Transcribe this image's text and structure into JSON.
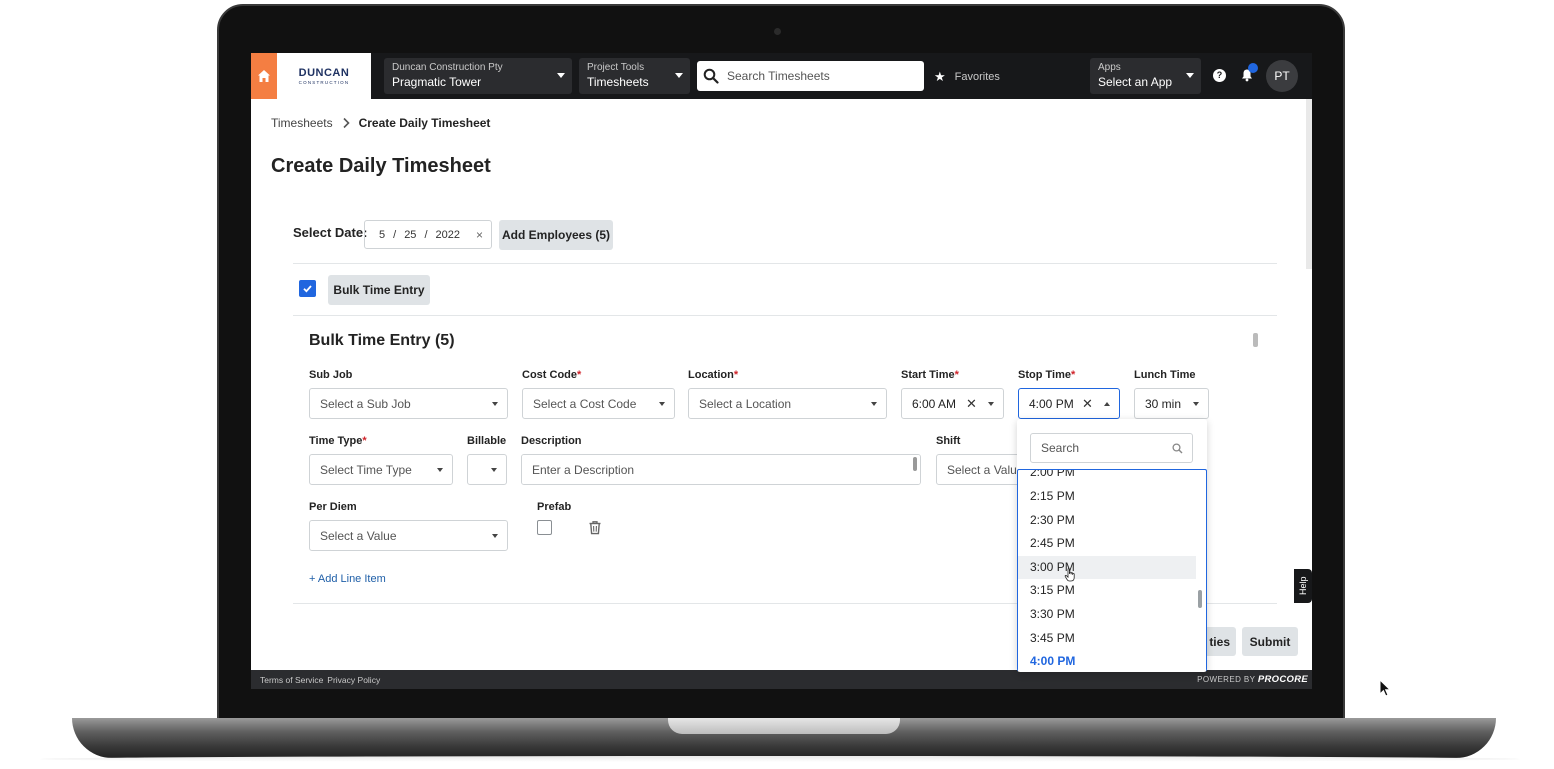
{
  "nav": {
    "company_small": "Duncan Construction Pty",
    "company_project": "Pragmatic Tower",
    "tools_small": "Project Tools",
    "tools_current": "Timesheets",
    "search_placeholder": "Search Timesheets",
    "favorites": "Favorites",
    "apps_small": "Apps",
    "apps_select": "Select an App",
    "help_glyph": "?",
    "avatar_initials": "PT",
    "logo_text": "DUNCAN",
    "logo_sub": "CONSTRUCTION",
    "accent_color": "#f47e42"
  },
  "breadcrumb": {
    "parent": "Timesheets",
    "separator": ">",
    "current": "Create Daily Timesheet"
  },
  "page": {
    "title": "Create Daily Timesheet"
  },
  "date_row": {
    "label": "Select Date:",
    "month": "5",
    "sep": "/",
    "day": "25",
    "year": "2022",
    "clear": "×",
    "add_employees": "Add Employees (5)"
  },
  "bulk": {
    "toggle_label": "Bulk Time Entry",
    "section_title": "Bulk Time Entry (5)",
    "fields": {
      "sub_job": {
        "label": "Sub Job",
        "placeholder": "Select a Sub Job"
      },
      "cost_code": {
        "label": "Cost Code",
        "placeholder": "Select a Cost Code"
      },
      "location": {
        "label": "Location",
        "placeholder": "Select a Location"
      },
      "start_time": {
        "label": "Start Time",
        "value": "6:00 AM"
      },
      "stop_time": {
        "label": "Stop Time",
        "value": "4:00 PM"
      },
      "lunch_time": {
        "label": "Lunch Time",
        "value": "30 min"
      },
      "time_type": {
        "label": "Time Type",
        "placeholder": "Select Time Type"
      },
      "billable": {
        "label": "Billable"
      },
      "description": {
        "label": "Description",
        "placeholder": "Enter a Description"
      },
      "shift": {
        "label": "Shift",
        "placeholder": "Select a Value"
      },
      "per_diem": {
        "label": "Per Diem",
        "placeholder": "Select a Value"
      },
      "prefab": {
        "label": "Prefab"
      }
    },
    "required_mark": "*",
    "clear_glyph": "✕",
    "add_line_item": "+ Add Line Item"
  },
  "stop_time_dropdown": {
    "search_placeholder": "Search",
    "partial_top_item": "2:00 PM",
    "items": [
      "2:15 PM",
      "2:30 PM",
      "2:45 PM",
      "3:00 PM",
      "3:15 PM",
      "3:30 PM",
      "3:45 PM",
      "4:00 PM"
    ],
    "hovered": "3:00 PM",
    "selected": "4:00 PM"
  },
  "actions": {
    "partial_button": "ties",
    "submit": "Submit"
  },
  "help_tab": "Help",
  "footer": {
    "terms": "Terms of Service",
    "privacy": "Privacy Policy",
    "powered_by": "POWERED BY",
    "brand": "PROCORE"
  }
}
